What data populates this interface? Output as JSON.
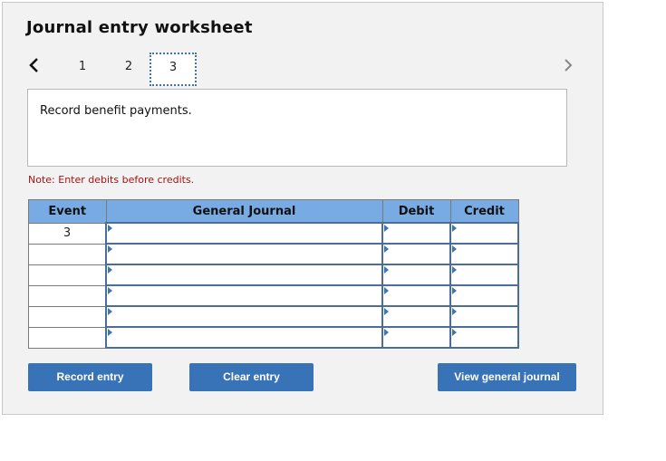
{
  "worksheet": {
    "title": "Journal entry worksheet",
    "nav": {
      "prev_icon": "chevron-left-icon",
      "next_icon": "chevron-right-icon",
      "tabs": [
        {
          "label": "1",
          "active": false
        },
        {
          "label": "2",
          "active": false
        },
        {
          "label": "3",
          "active": true
        }
      ]
    },
    "description": "Record benefit payments.",
    "note": "Note: Enter debits before credits.",
    "table": {
      "headers": [
        "Event",
        "General Journal",
        "Debit",
        "Credit"
      ],
      "rows": [
        {
          "event": "3",
          "account": "",
          "debit": "",
          "credit": ""
        },
        {
          "event": "",
          "account": "",
          "debit": "",
          "credit": ""
        },
        {
          "event": "",
          "account": "",
          "debit": "",
          "credit": ""
        },
        {
          "event": "",
          "account": "",
          "debit": "",
          "credit": ""
        },
        {
          "event": "",
          "account": "",
          "debit": "",
          "credit": ""
        },
        {
          "event": "",
          "account": "",
          "debit": "",
          "credit": ""
        }
      ]
    },
    "buttons": {
      "record": "Record entry",
      "clear": "Clear entry",
      "view": "View general journal"
    },
    "colors": {
      "accent": "#3873b8",
      "header_bg": "#78abe3",
      "note": "#a31515",
      "panel_bg": "#f2f2f2"
    }
  }
}
